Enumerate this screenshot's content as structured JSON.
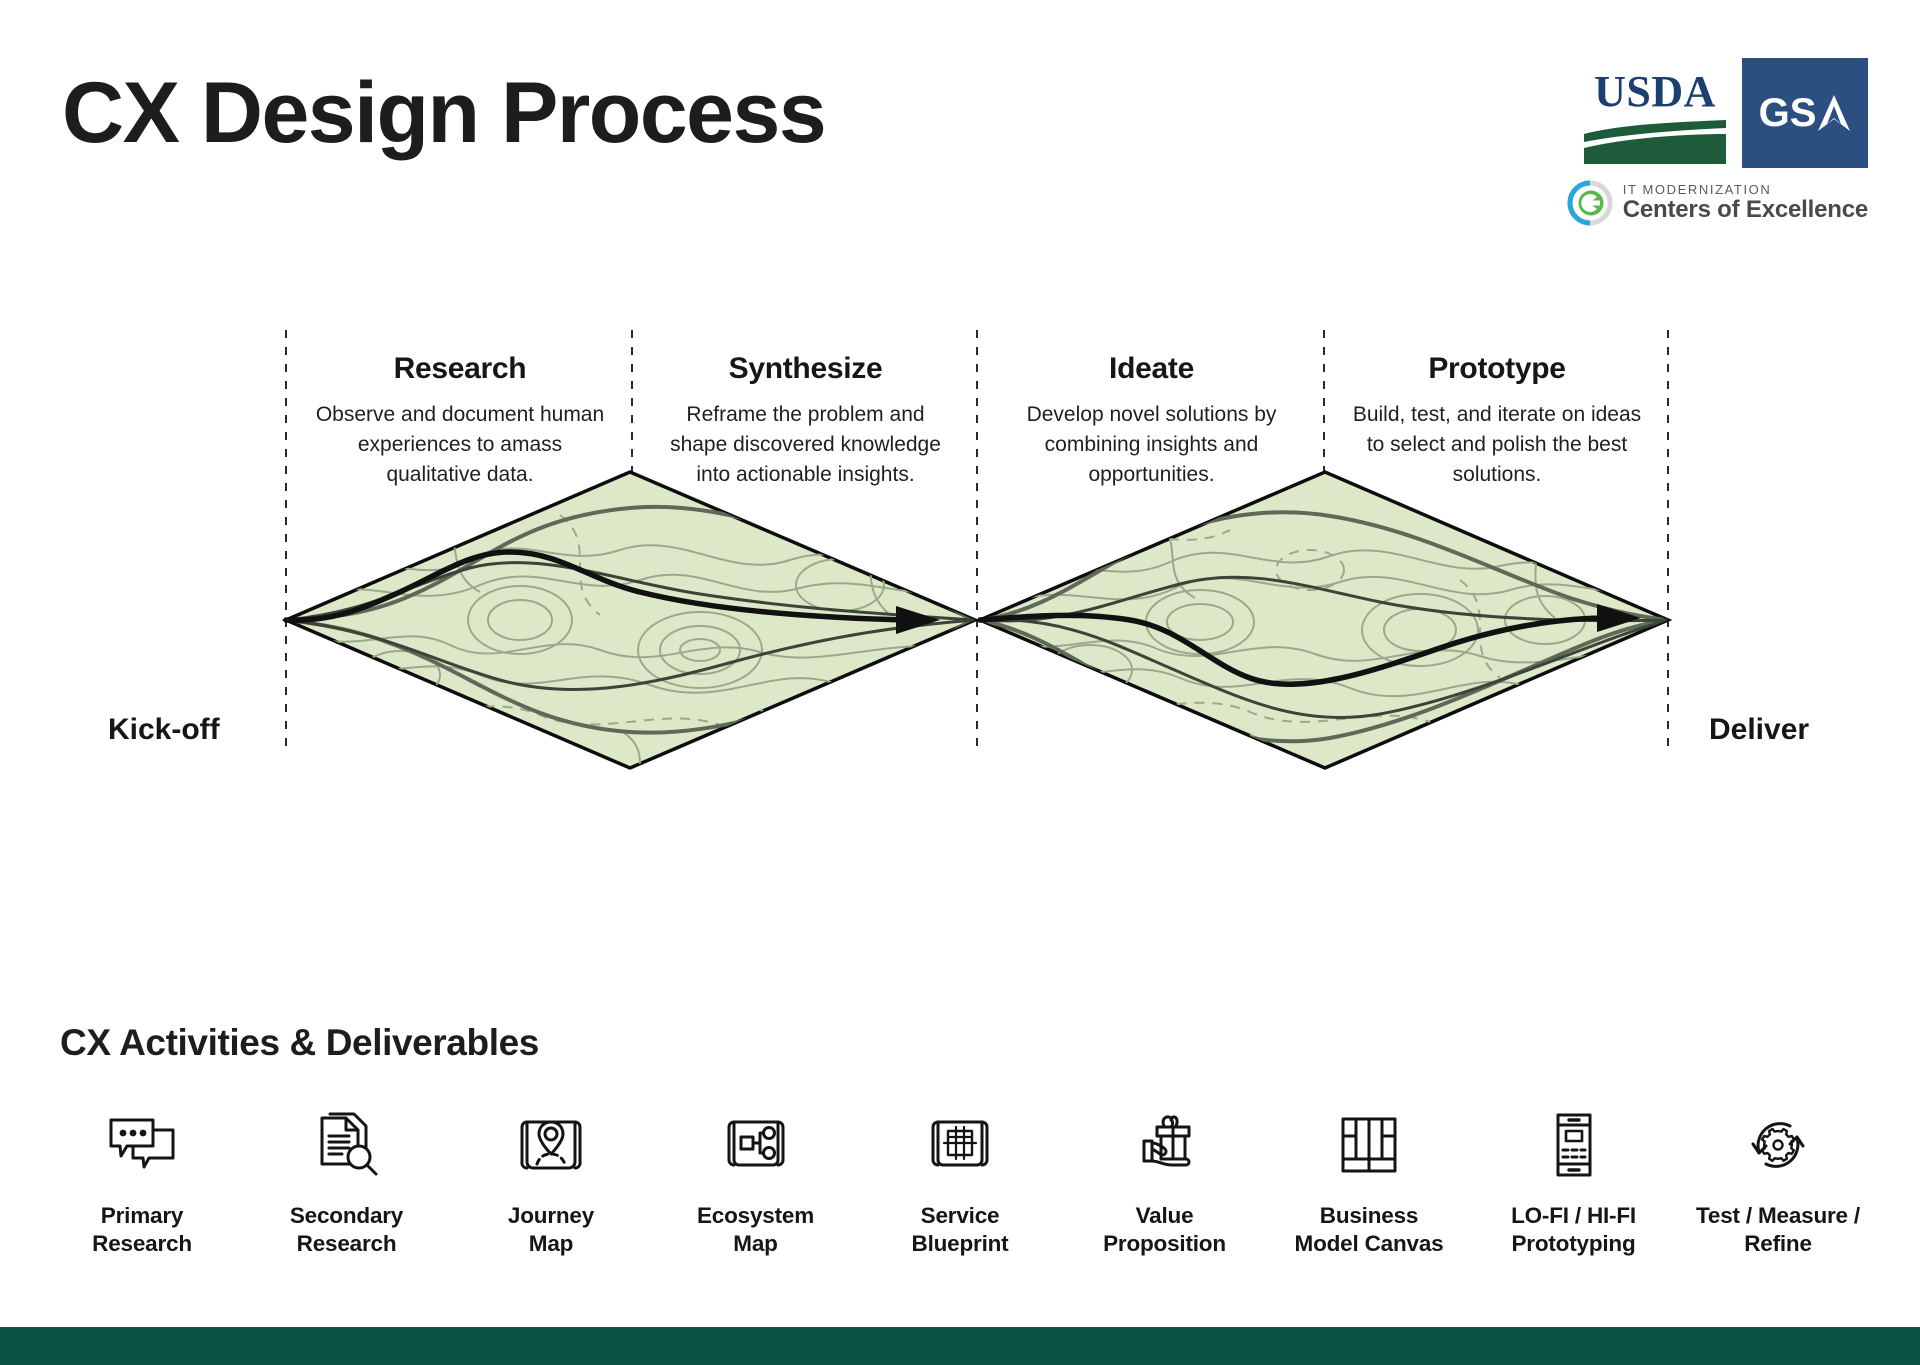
{
  "header": {
    "title": "CX Design Process",
    "logos": {
      "usda": "USDA",
      "gsa": "GSA",
      "coe_sub": "IT MODERNIZATION",
      "coe_main": "Centers of Excellence"
    }
  },
  "diagram": {
    "start_label": "Kick-off",
    "end_label": "Deliver",
    "phases": [
      {
        "title": "Research",
        "description": "Observe and document human experiences to amass qualitative data."
      },
      {
        "title": "Synthesize",
        "description": "Reframe the problem and shape discovered knowledge into actionable insights."
      },
      {
        "title": "Ideate",
        "description": "Develop novel solutions by combining insights and opportunities."
      },
      {
        "title": "Prototype",
        "description": "Build, test, and iterate on ideas to select and polish the best solutions."
      }
    ],
    "colors": {
      "diamond_fill": "#dde8c9",
      "diamond_stroke": "#000000",
      "contour_line": "#9aa98c",
      "path_line": "#1a1a1a"
    }
  },
  "activities": {
    "heading": "CX Activities & Deliverables",
    "items": [
      {
        "label": "Primary\nResearch",
        "icon": "speech-bubbles-icon"
      },
      {
        "label": "Secondary\nResearch",
        "icon": "documents-magnifier-icon"
      },
      {
        "label": "Journey\nMap",
        "icon": "map-pin-scroll-icon"
      },
      {
        "label": "Ecosystem\nMap",
        "icon": "node-diagram-scroll-icon"
      },
      {
        "label": "Service\nBlueprint",
        "icon": "blueprint-scroll-icon"
      },
      {
        "label": "Value\nProposition",
        "icon": "hand-gift-icon"
      },
      {
        "label": "Business\nModel Canvas",
        "icon": "canvas-grid-icon"
      },
      {
        "label": "LO-FI / HI-FI\nPrototyping",
        "icon": "mobile-wireframe-icon"
      },
      {
        "label": "Test / Measure /\nRefine",
        "icon": "gear-refresh-icon"
      }
    ]
  },
  "footer": {
    "bar_color": "#0b5343"
  }
}
